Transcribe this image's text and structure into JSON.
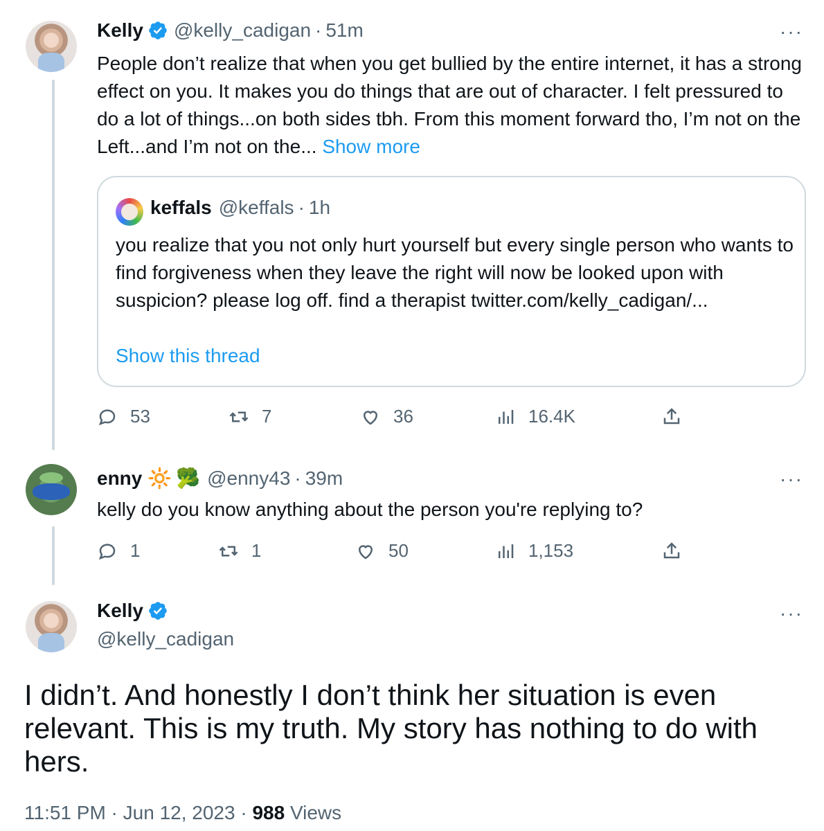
{
  "tweet1": {
    "name": "Kelly",
    "handle": "@kelly_cadigan",
    "separator": "·",
    "time": "51m",
    "more": "···",
    "text": "People don’t realize that when you get bullied by the entire internet, it has a strong effect on you. It makes you do things that are out of character. I felt pressured to do a lot of things...on both sides tbh. From this moment forward tho, I’m not on the Left...and I’m not on the...",
    "show_more": "Show more",
    "quote": {
      "name": "keffals",
      "handle": "@keffals",
      "separator": "·",
      "time": "1h",
      "text": "you realize that you not only hurt yourself but every single person who wants to find forgiveness when they leave the right will now be looked upon with suspicion? please log off. find a therapist twitter.com/kelly_cadigan/...",
      "show_thread": "Show this thread"
    },
    "stats": {
      "replies": "53",
      "retweets": "7",
      "likes": "36",
      "views": "16.4K"
    }
  },
  "tweet2": {
    "name": "enny",
    "emoji1": "🔆",
    "emoji2": "🥦",
    "handle": "@enny43",
    "separator": "·",
    "time": "39m",
    "more": "···",
    "text": "kelly do you know anything about the person you're replying to?",
    "stats": {
      "replies": "1",
      "retweets": "1",
      "likes": "50",
      "views": "1,153"
    }
  },
  "tweet3": {
    "name": "Kelly",
    "handle": "@kelly_cadigan",
    "more": "···",
    "text": "I didn’t. And honestly I don’t think her situation is even relevant. This is my truth. My story has nothing to do with hers.",
    "timestamp": "11:51 PM · Jun 12, 2023 ·",
    "views_count": "988",
    "views_label": "Views"
  },
  "colors": {
    "link": "#1d9bf0",
    "secondary": "#536471",
    "verified": "#1d9bf0",
    "border": "#cfd9de"
  },
  "icons": [
    "verified-badge-icon",
    "more-icon",
    "reply-icon",
    "retweet-icon",
    "like-icon",
    "views-icon",
    "share-icon"
  ]
}
